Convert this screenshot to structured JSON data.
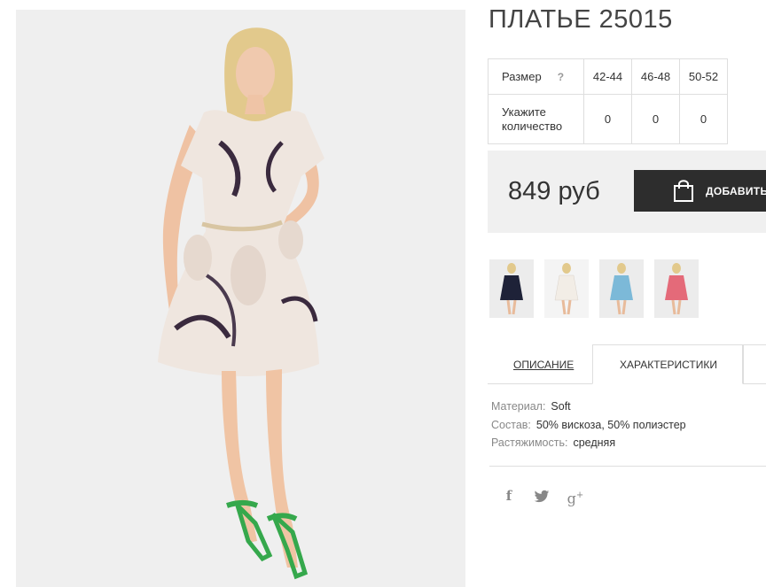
{
  "product": {
    "title": "ПЛАТЬЕ 25015",
    "price": "849 руб",
    "add_button_label": "ДОБАВИТЬ"
  },
  "size_table": {
    "size_label": "Размер",
    "help_mark": "?",
    "sizes": [
      "42-44",
      "46-48",
      "50-52"
    ],
    "quantity_label": "Укажите количество",
    "quantities": [
      "0",
      "0",
      "0"
    ]
  },
  "thumbnails": [
    {
      "name": "thumb-navy-dress",
      "color": "#1e2238"
    },
    {
      "name": "thumb-white-dress",
      "color": "#f2ede6"
    },
    {
      "name": "thumb-blue-dress",
      "color": "#7cb9d8"
    },
    {
      "name": "thumb-pink-dress",
      "color": "#e46a79"
    }
  ],
  "tabs": {
    "description": "ОПИСАНИЕ",
    "characteristics": "ХАРАКТЕРИСТИКИ",
    "active": "characteristics"
  },
  "specs": [
    {
      "key": "Материал:",
      "value": "Soft"
    },
    {
      "key": "Состав:",
      "value": "50% вискоза, 50% полиэстер"
    },
    {
      "key": "Растяжимость:",
      "value": "средняя"
    }
  ],
  "social": {
    "facebook": "f",
    "google": "g"
  },
  "icons": [
    "shopping-bag-icon",
    "facebook-icon",
    "twitter-icon",
    "google-plus-icon"
  ],
  "colors": {
    "button_bg": "#2d2d2d",
    "price_bg": "#f0f0f0",
    "border": "#dedede"
  }
}
